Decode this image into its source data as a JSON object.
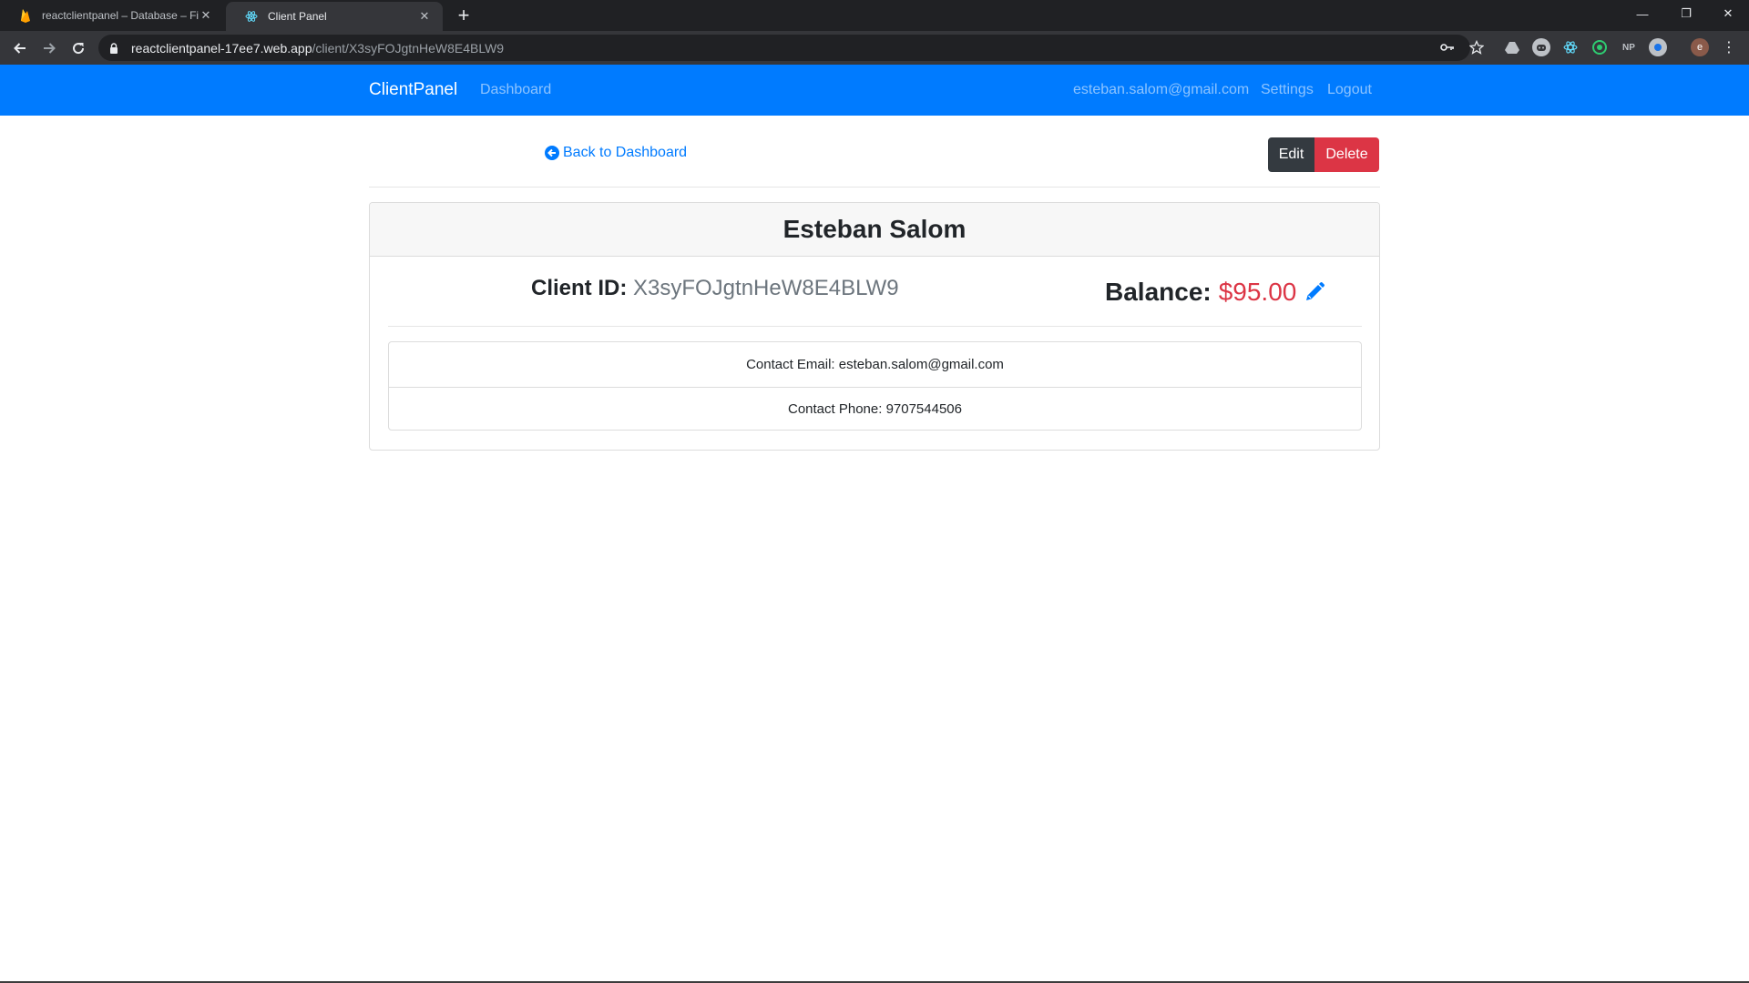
{
  "browser": {
    "tabs": [
      {
        "title": "reactclientpanel – Database – Firebase",
        "favicon": "firebase-icon",
        "active": false
      },
      {
        "title": "Client Panel",
        "favicon": "react-icon",
        "active": true
      }
    ],
    "close_glyph": "✕",
    "new_tab_glyph": "+",
    "window_controls": {
      "minimize": "—",
      "restore": "❐",
      "close": "✕"
    },
    "address": {
      "host": "reactclientpanel-17ee7.web.app",
      "path": "/client/X3syFOJgtnHeW8E4BLW9"
    },
    "extensions": [
      "drive-icon",
      "discord-icon",
      "react-devtools-icon",
      "redux-icon",
      "NP",
      "extension-icon"
    ],
    "profile_initial": "e"
  },
  "navbar": {
    "brand": "ClientPanel",
    "dashboard": "Dashboard",
    "user_email": "esteban.salom@gmail.com",
    "settings": "Settings",
    "logout": "Logout",
    "color": "#007bff"
  },
  "page": {
    "back_link": "Back to Dashboard",
    "edit_label": "Edit",
    "delete_label": "Delete"
  },
  "client": {
    "name": "Esteban Salom",
    "id_label": "Client ID:",
    "id": "X3syFOJgtnHeW8E4BLW9",
    "balance_label": "Balance:",
    "balance": "$95.00",
    "contact_email_label": "Contact Email:",
    "contact_email": "esteban.salom@gmail.com",
    "contact_phone_label": "Contact Phone:",
    "contact_phone": "9707544506"
  },
  "colors": {
    "primary": "#007bff",
    "danger": "#dc3545",
    "dark": "#343a40",
    "muted": "#6c757d"
  }
}
